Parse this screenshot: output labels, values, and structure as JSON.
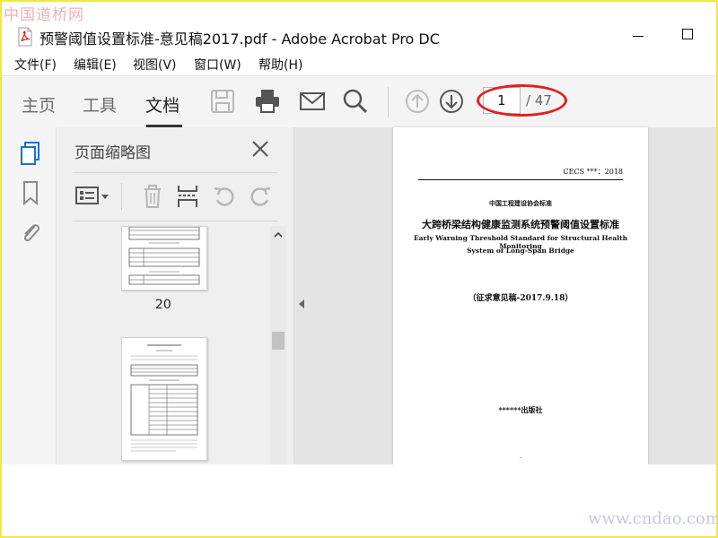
{
  "watermarks": {
    "top": "中国道桥网",
    "bottom": "www.cndao.com"
  },
  "window": {
    "title": "预警阈值设置标准-意见稿2017.pdf - Adobe Acrobat Pro DC"
  },
  "menu": [
    "文件(F)",
    "编辑(E)",
    "视图(V)",
    "窗口(W)",
    "帮助(H)"
  ],
  "toolbar": {
    "tabs": [
      "主页",
      "工具",
      "文档"
    ],
    "active_tab": "文档",
    "icons": [
      "save-icon",
      "print-icon",
      "email-icon",
      "search-icon",
      "page-up-icon",
      "page-down-icon"
    ],
    "current_page": "1",
    "total_pages": "/ 47",
    "annotation_color": "#e02020"
  },
  "leftbar": {
    "icons": [
      "page-thumbnails-icon",
      "bookmark-icon",
      "attachment-icon"
    ],
    "accent": "#1a73c8"
  },
  "panel": {
    "title": "页面缩略图",
    "tools": [
      "options-icon",
      "delete-icon",
      "insert-page-icon",
      "rotate-left-icon",
      "rotate-right-icon"
    ],
    "thumbnails": [
      {
        "page": "20"
      }
    ]
  },
  "document": {
    "cecs": "CECS ***：2018",
    "association": "中国工程建设协会标准",
    "title_cn": "大跨桥梁结构健康监测系统预警阈值设置标准",
    "title_en_1": "Early Warning Threshold Standard for Structural Health Monitoring",
    "title_en_2": "System of Long-Span Bridge",
    "draft": "（征求意见稿-2017.9.18）",
    "publisher": "******出版社",
    "footer_mark": "·"
  }
}
